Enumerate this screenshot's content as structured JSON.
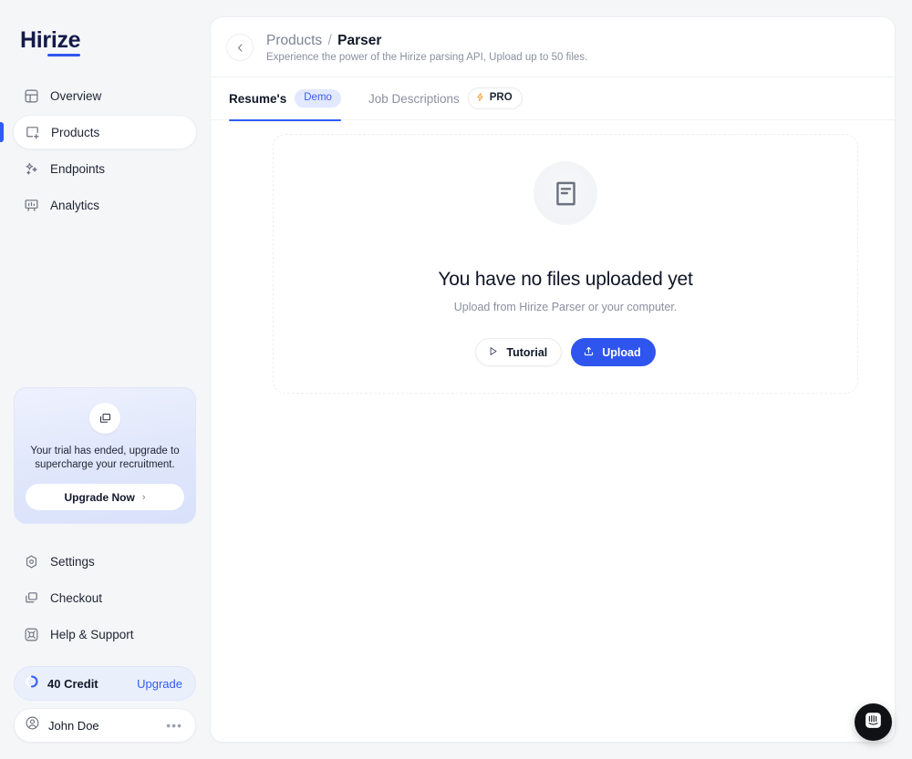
{
  "brand": {
    "name": "Hirize"
  },
  "sidebar": {
    "nav": [
      {
        "label": "Overview",
        "icon": "layout-grid-icon",
        "active": false
      },
      {
        "label": "Products",
        "icon": "product-box-icon",
        "active": true
      },
      {
        "label": "Endpoints",
        "icon": "sparkles-icon",
        "active": false
      },
      {
        "label": "Analytics",
        "icon": "chart-presentation-icon",
        "active": false
      }
    ],
    "trial_card": {
      "icon": "stacked-cards-icon",
      "text": "Your trial has ended, upgrade to supercharge your recruitment.",
      "button_label": "Upgrade Now",
      "button_chevron": "›"
    },
    "bottom_nav": [
      {
        "label": "Settings",
        "icon": "gear-icon"
      },
      {
        "label": "Checkout",
        "icon": "stacked-cards-icon"
      },
      {
        "label": "Help & Support",
        "icon": "lifebuoy-icon"
      }
    ],
    "credit": {
      "icon": "credit-ring-icon",
      "label": "40 Credit",
      "action_label": "Upgrade"
    },
    "user": {
      "icon": "avatar-icon",
      "name": "John Doe",
      "menu_glyph": "•••"
    }
  },
  "header": {
    "back_icon": "chevron-left-icon",
    "breadcrumb_parent": "Products",
    "breadcrumb_separator": "/",
    "breadcrumb_current": "Parser",
    "subtitle": "Experience the power of the Hirize parsing API, Upload up to 50 files."
  },
  "tabs": [
    {
      "label": "Resume's",
      "badge": "Demo",
      "badge_type": "demo",
      "active": true
    },
    {
      "label": "Job Descriptions",
      "badge": "PRO",
      "badge_type": "pro",
      "badge_icon": "lightning-bolt-icon",
      "active": false
    }
  ],
  "empty_state": {
    "icon": "document-icon",
    "title": "You have no files uploaded yet",
    "subtitle": "Upload from Hirize Parser or your computer.",
    "tutorial_button": {
      "label": "Tutorial",
      "icon": "play-icon"
    },
    "upload_button": {
      "label": "Upload",
      "icon": "upload-arrow-icon"
    }
  },
  "chat_widget": {
    "icon": "intercom-icon"
  },
  "colors": {
    "accent_blue": "#2f55ef",
    "brand_navy": "#131a4a",
    "page_bg": "#f5f6f8",
    "card_bg": "#ffffff",
    "muted_text": "#8a90a0",
    "badge_demo_bg": "#e2e8fd",
    "pro_bolt": "#f59e35",
    "chat_bg": "#0f1114"
  }
}
